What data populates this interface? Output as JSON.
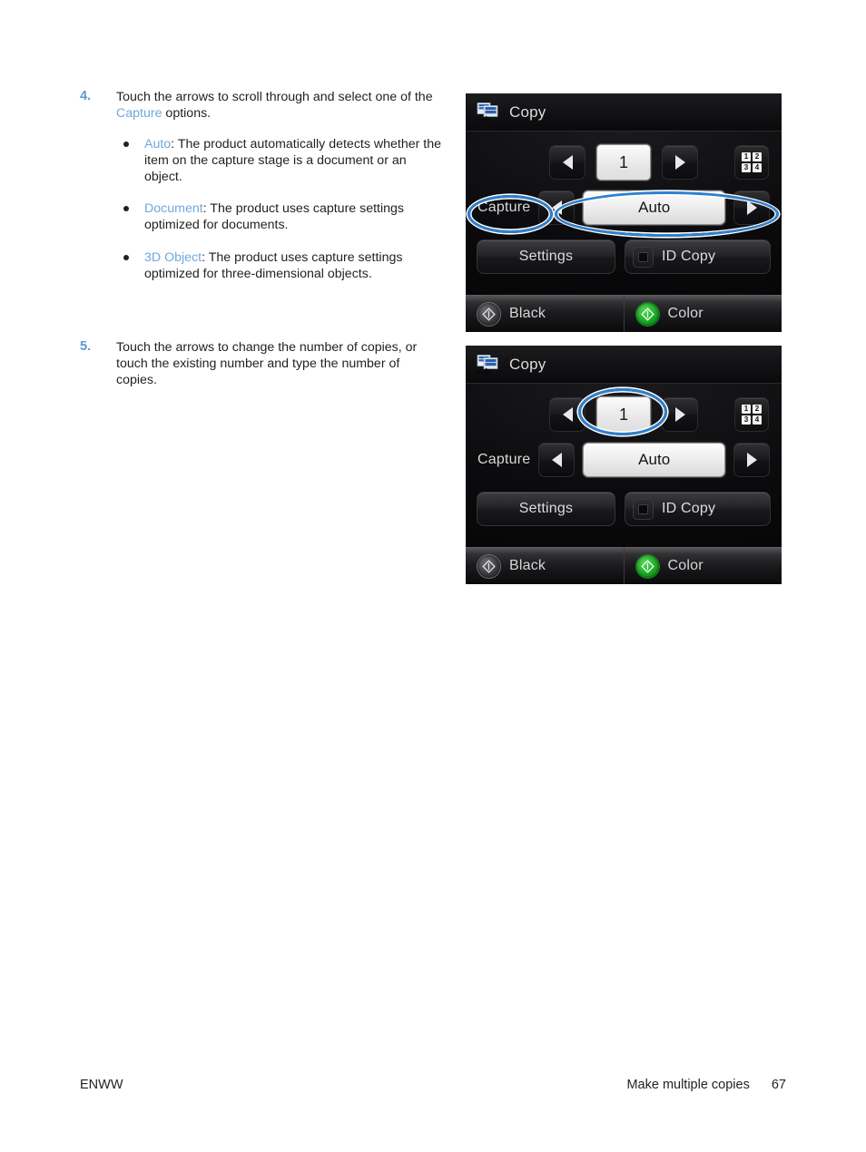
{
  "document": {
    "footer": {
      "left": "ENWW",
      "section": "Make multiple copies",
      "page_number": "67"
    },
    "link_color": "#6fa8dc",
    "step_number_color": "#5b9bd5"
  },
  "steps": [
    {
      "number": "4.",
      "text_before_link": "Touch the arrows to scroll through and select one of the ",
      "link": "Capture",
      "text_after_link": " options.",
      "bullets": [
        {
          "term": "Auto",
          "description": ": The product automatically detects whether the item on the capture stage is a document or an object."
        },
        {
          "term": "Document",
          "description": ": The product uses capture settings optimized for documents."
        },
        {
          "term": "3D Object",
          "description": ": The product uses capture settings optimized for three-dimensional objects."
        }
      ]
    },
    {
      "number": "5.",
      "text": "Touch the arrows to change the number of copies, or touch the existing number and type the number of copies."
    }
  ],
  "device_screens": [
    {
      "title": "Copy",
      "copies_value": "1",
      "left_arrow": "◀",
      "right_arrow": "▶",
      "keypad_keys": [
        "1",
        "2",
        "3",
        "4"
      ],
      "capture_label": "Capture",
      "capture_value": "Auto",
      "settings_label": "Settings",
      "id_copy_label": "ID Copy",
      "black_label": "Black",
      "color_label": "Color",
      "callouts": [
        "capture-label",
        "capture-selector"
      ]
    },
    {
      "title": "Copy",
      "copies_value": "1",
      "left_arrow": "◀",
      "right_arrow": "▶",
      "keypad_keys": [
        "1",
        "2",
        "3",
        "4"
      ],
      "capture_label": "Capture",
      "capture_value": "Auto",
      "settings_label": "Settings",
      "id_copy_label": "ID Copy",
      "black_label": "Black",
      "color_label": "Color",
      "callouts": [
        "copies-field"
      ]
    }
  ]
}
